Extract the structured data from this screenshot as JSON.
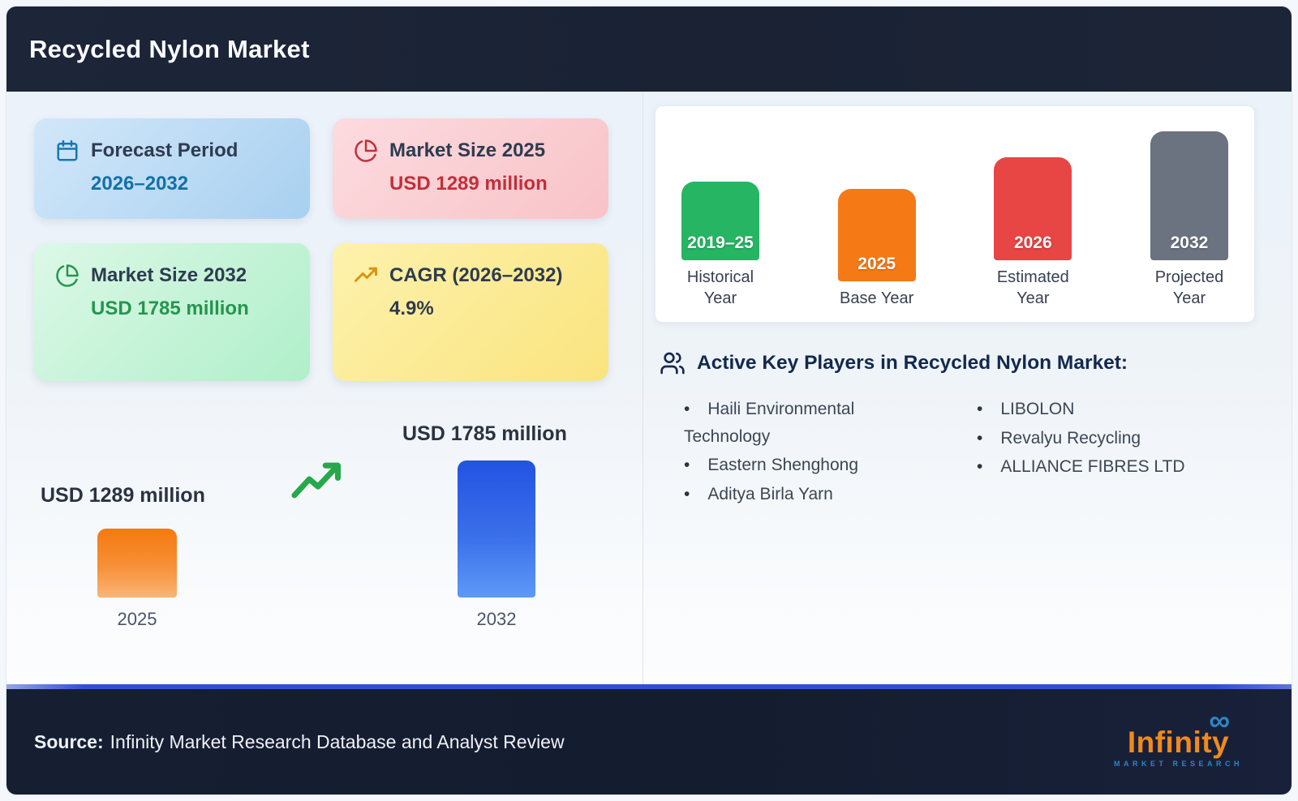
{
  "header": {
    "title": "Recycled Nylon Market"
  },
  "cards": [
    {
      "icon": "calendar-icon",
      "title": "Forecast Period",
      "value": "2026–2032"
    },
    {
      "icon": "pie-chart-icon",
      "title": "Market Size 2025",
      "value": "USD 1289 million"
    },
    {
      "icon": "pie-chart-icon",
      "title": "Market Size 2032",
      "value": "USD 1785 million"
    },
    {
      "icon": "trending-up-icon",
      "title": "CAGR (2026–2032)",
      "value": "4.9%"
    }
  ],
  "chart_data": [
    {
      "type": "bar",
      "title": "Recycled Nylon Market growth 2025 vs 2032",
      "categories": [
        "2025",
        "2032"
      ],
      "values": [
        1289,
        1785
      ],
      "unit": "USD million",
      "value_labels": [
        "USD 1289 million",
        "USD 1785 million"
      ],
      "colors": [
        "#f5790f",
        "#2253e2"
      ],
      "annotations": [
        "growth-arrow-icon"
      ]
    },
    {
      "type": "bar",
      "title": "Market study timeline",
      "categories": [
        "Historical Year",
        "Base Year",
        "Estimated Year",
        "Projected Year"
      ],
      "bar_labels": [
        "2019–25",
        "2025",
        "2026",
        "2032"
      ],
      "values": [
        97,
        114,
        127,
        159
      ],
      "colors": [
        "#26b563",
        "#f57a16",
        "#e84545",
        "#6b7280"
      ]
    }
  ],
  "key_players": {
    "icon": "users-icon",
    "title": "Active Key Players in Recycled Nylon Market:",
    "columns": [
      [
        "Haili Environmental Technology",
        "Eastern Shenghong",
        "Aditya Birla Yarn"
      ],
      [
        "LIBOLON",
        "Revalyu Recycling",
        "ALLIANCE FIBRES LTD"
      ]
    ]
  },
  "footer": {
    "source_label": "Source:",
    "source_text": "Infinity Market Research Database and Analyst Review",
    "accent_color": "#3350cf",
    "logo": {
      "glyph": "∞",
      "name": "Infinity",
      "subtitle": "MARKET RESEARCH"
    }
  }
}
